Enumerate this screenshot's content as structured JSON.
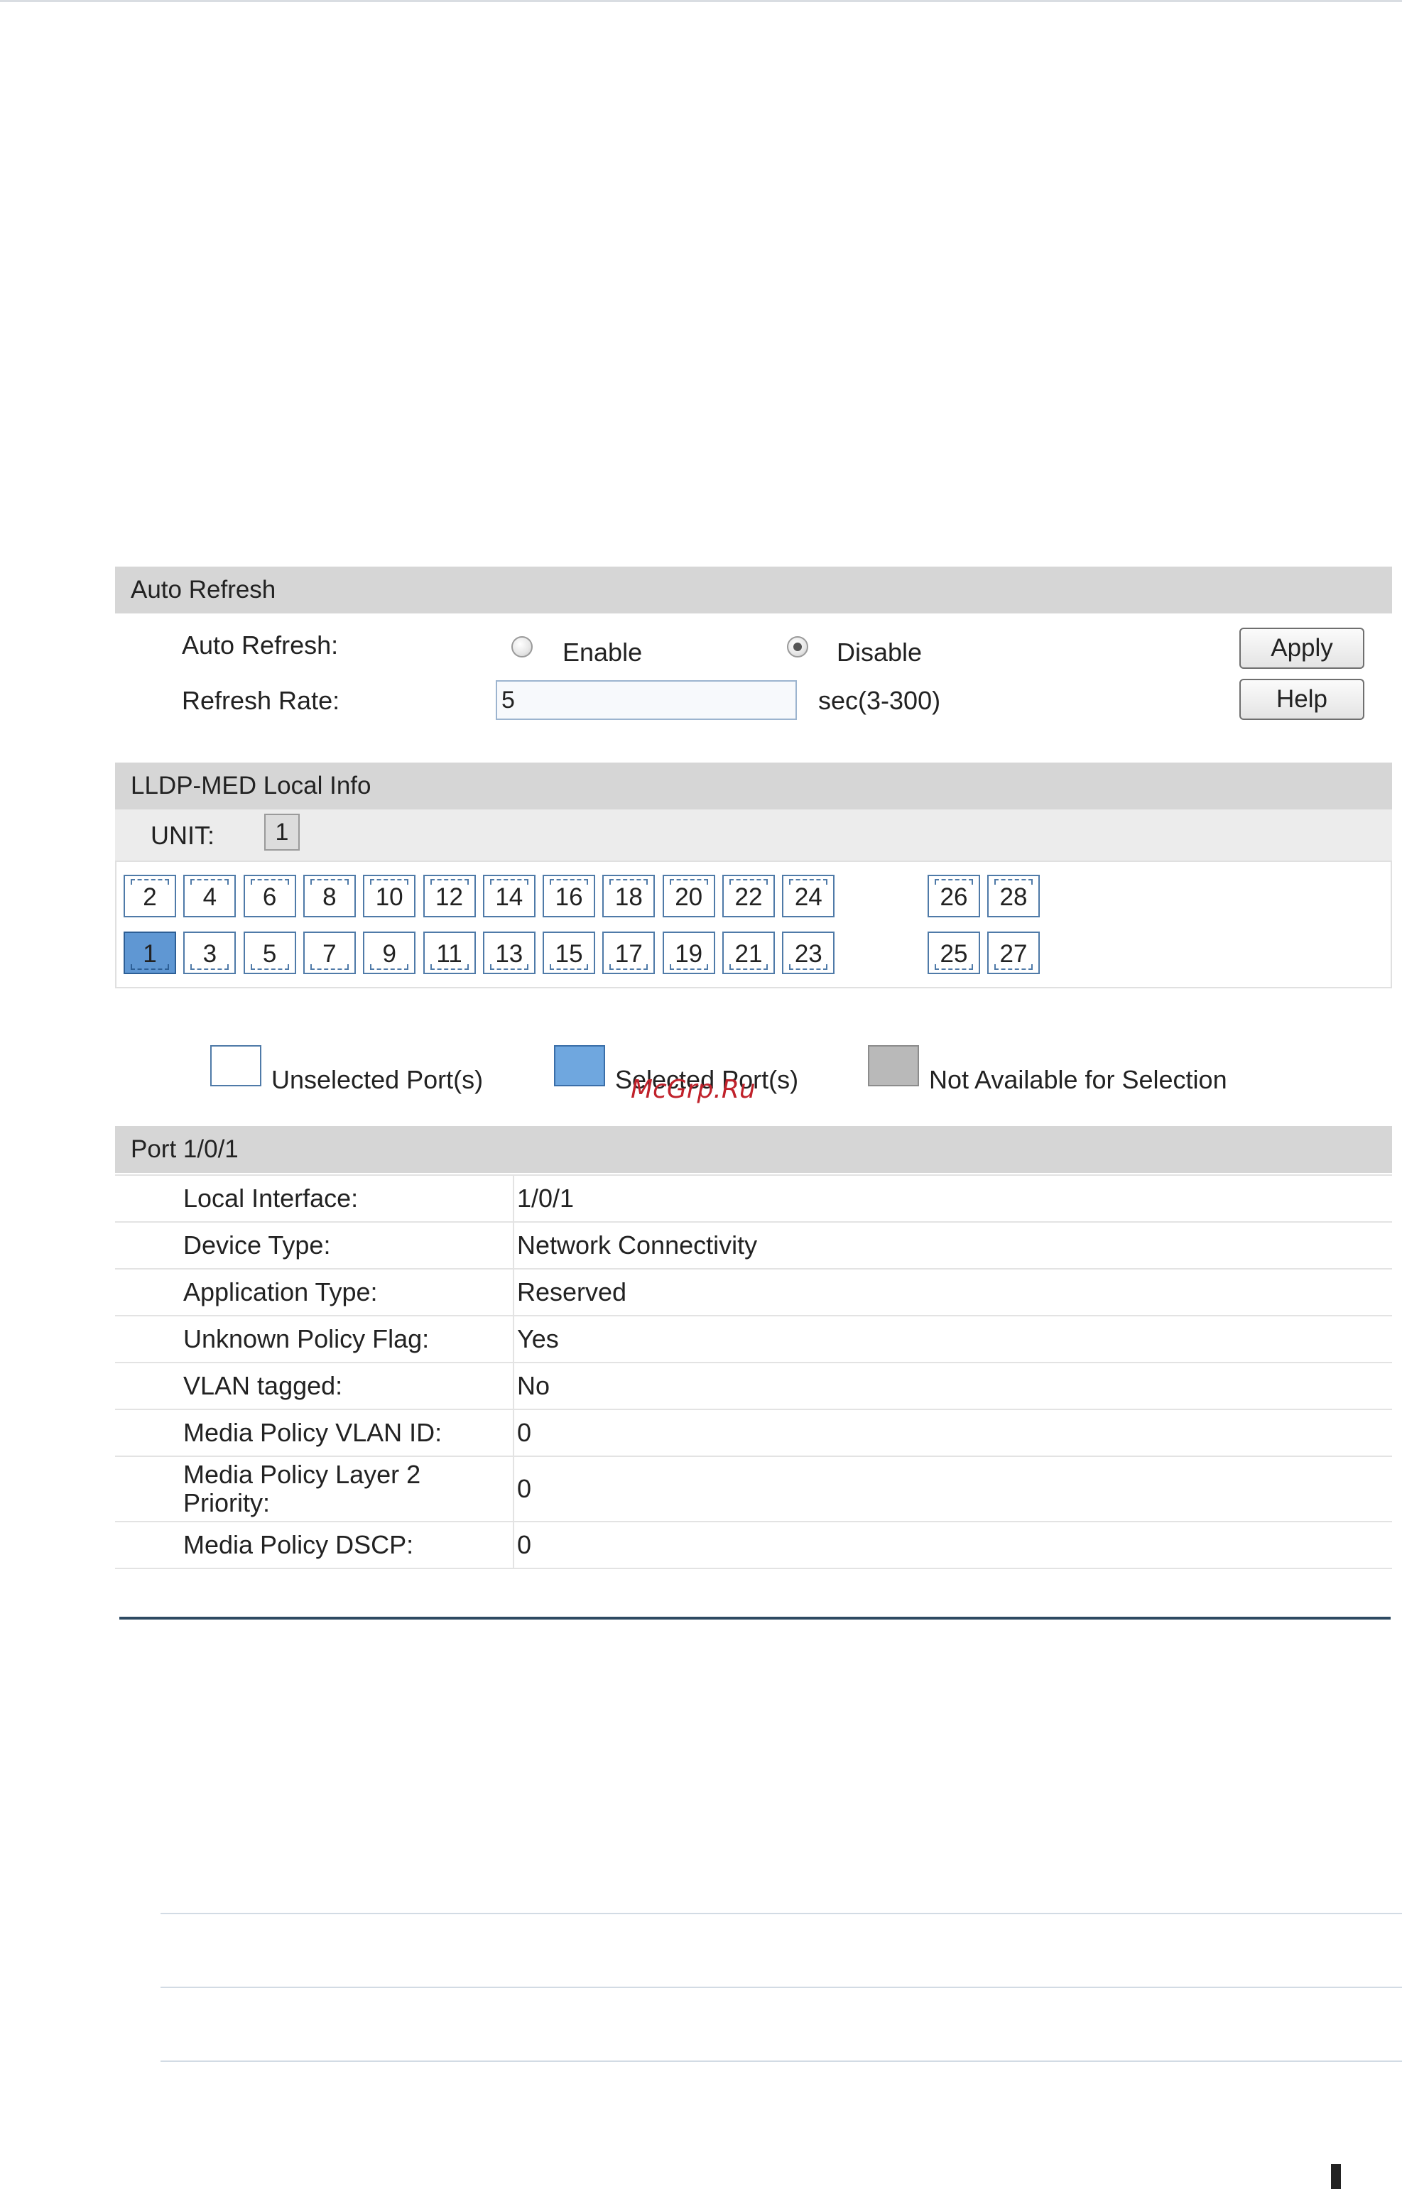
{
  "auto_refresh": {
    "section_title": "Auto Refresh",
    "auto_refresh_label": "Auto Refresh:",
    "enable_label": "Enable",
    "disable_label": "Disable",
    "selected": "Disable",
    "refresh_rate_label": "Refresh Rate:",
    "refresh_rate_value": "5",
    "refresh_rate_hint": "sec(3-300)",
    "apply_label": "Apply",
    "help_label": "Help"
  },
  "lldp_med": {
    "section_title": "LLDP-MED Local Info",
    "unit_label": "UNIT:",
    "unit_value": "1",
    "ports_top": [
      "2",
      "4",
      "6",
      "8",
      "10",
      "12",
      "14",
      "16",
      "18",
      "20",
      "22",
      "24",
      "26",
      "28"
    ],
    "ports_bottom": [
      "1",
      "3",
      "5",
      "7",
      "9",
      "11",
      "13",
      "15",
      "17",
      "19",
      "21",
      "23",
      "25",
      "27"
    ],
    "selected_port": "1"
  },
  "legend": {
    "unselected": "Unselected Port(s)",
    "selected": "Selected Port(s)",
    "not_available": "Not Available for Selection"
  },
  "watermark": "McGrp.Ru",
  "port_info": {
    "section_title": "Port 1/0/1",
    "rows": [
      {
        "key": "Local Interface:",
        "value": "1/0/1"
      },
      {
        "key": "Device Type:",
        "value": "Network Connectivity"
      },
      {
        "key": "Application Type:",
        "value": "Reserved"
      },
      {
        "key": "Unknown Policy Flag:",
        "value": "Yes"
      },
      {
        "key": "VLAN tagged:",
        "value": "No"
      },
      {
        "key": "Media Policy VLAN ID:",
        "value": "0"
      },
      {
        "key": "Media Policy Layer 2 Priority:",
        "value": "0"
      },
      {
        "key": "Media Policy DSCP:",
        "value": "0"
      }
    ]
  }
}
